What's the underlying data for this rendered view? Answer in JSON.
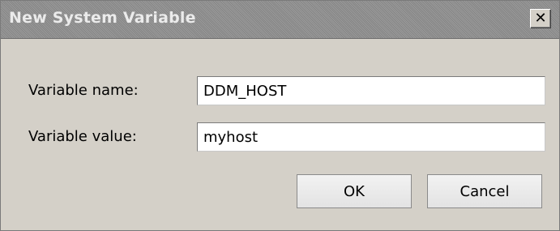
{
  "window": {
    "title": "New System Variable",
    "close_glyph": "✕"
  },
  "form": {
    "name_label": "Variable name:",
    "name_value": "DDM_HOST",
    "value_label": "Variable value:",
    "value_value": "myhost"
  },
  "buttons": {
    "ok_label": "OK",
    "cancel_label": "Cancel"
  }
}
